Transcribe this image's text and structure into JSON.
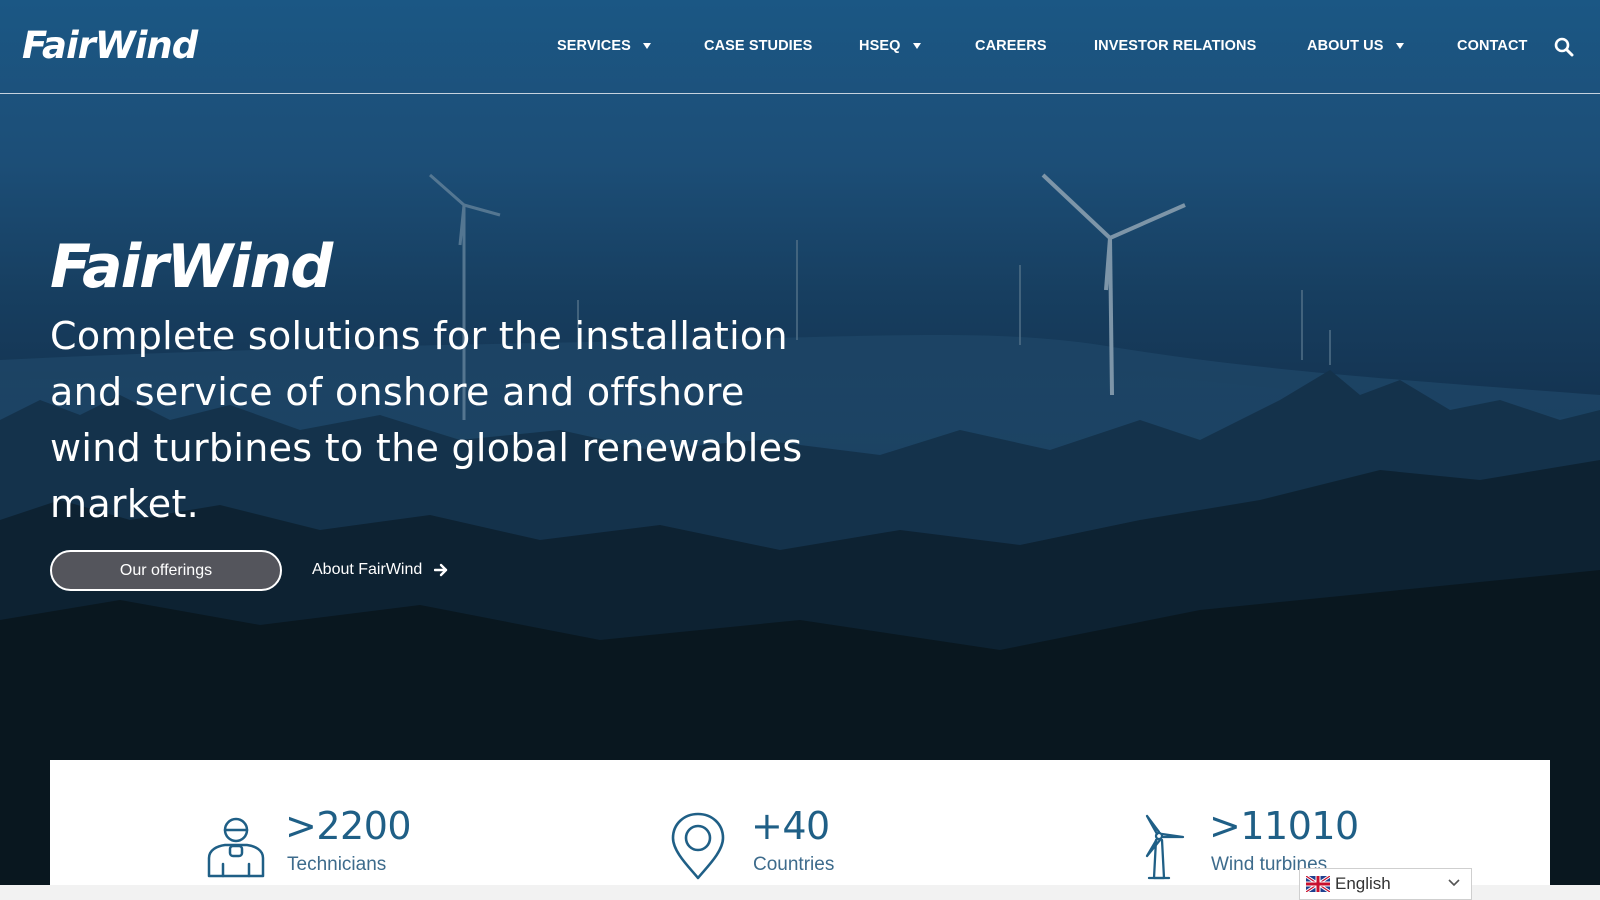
{
  "brand": {
    "logo_text": "FairWind"
  },
  "nav": {
    "items": [
      {
        "label": "SERVICES",
        "has_dropdown": true
      },
      {
        "label": "CASE STUDIES",
        "has_dropdown": false
      },
      {
        "label": "HSEQ",
        "has_dropdown": true
      },
      {
        "label": "CAREERS",
        "has_dropdown": false
      },
      {
        "label": "INVESTOR RELATIONS",
        "has_dropdown": false
      },
      {
        "label": "ABOUT US",
        "has_dropdown": true
      },
      {
        "label": "CONTACT",
        "has_dropdown": false
      }
    ],
    "search_icon": "search-icon"
  },
  "hero": {
    "title": "FairWind",
    "subtitle": "Complete solutions for the installation and service of onshore and offshore wind turbines to the global renewables market.",
    "primary_button": "Our offerings",
    "secondary_link": "About FairWind",
    "secondary_link_icon": "arrow-right-icon"
  },
  "stats": [
    {
      "value": ">2200",
      "label": "Technicians",
      "icon": "technician-icon"
    },
    {
      "value": "+40",
      "label": "Countries",
      "icon": "location-pin-icon"
    },
    {
      "value": ">11010",
      "label": "Wind turbines",
      "icon": "wind-turbine-icon"
    }
  ],
  "language_selector": {
    "label": "English",
    "flag_icon": "uk-flag-icon"
  },
  "colors": {
    "accent": "#1f5f86",
    "hero_top": "#1b5784",
    "hero_bottom": "#08161f"
  }
}
